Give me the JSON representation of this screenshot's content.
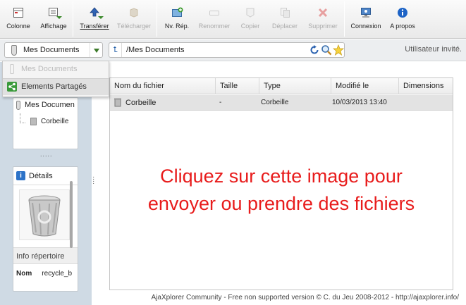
{
  "toolbar": {
    "buttons": [
      {
        "label": "Colonne",
        "icon": "column-view-icon",
        "disabled": false
      },
      {
        "label": "Affichage",
        "icon": "display-mode-icon",
        "disabled": false
      },
      {
        "label": "Transférer",
        "icon": "upload-icon",
        "disabled": false
      },
      {
        "label": "Télécharger",
        "icon": "download-icon",
        "disabled": true
      },
      {
        "label": "Nv. Rép.",
        "icon": "new-folder-icon",
        "disabled": false
      },
      {
        "label": "Renommer",
        "icon": "rename-icon",
        "disabled": true
      },
      {
        "label": "Copier",
        "icon": "copy-icon",
        "disabled": true
      },
      {
        "label": "Déplacer",
        "icon": "move-icon",
        "disabled": true
      },
      {
        "label": "Supprimer",
        "icon": "delete-icon",
        "disabled": true
      },
      {
        "label": "Connexion",
        "icon": "login-icon",
        "disabled": false
      },
      {
        "label": "A propos",
        "icon": "about-icon",
        "disabled": false
      }
    ]
  },
  "pathbar": {
    "repository": "Mes Documents",
    "path": "/Mes Documents",
    "user_status": "Utilisateur invité."
  },
  "repo_dropdown": {
    "items": [
      {
        "label": "Mes Documents",
        "icon": "user-repo-icon"
      },
      {
        "label": "Elements Partagés",
        "icon": "share-icon"
      }
    ]
  },
  "tree": {
    "root": "Mes Documen",
    "child": "Corbeille"
  },
  "details": {
    "title": "Détails",
    "info_section": "Info répertoire",
    "nom_label": "Nom",
    "nom_value": "recycle_b"
  },
  "file_list": {
    "columns": [
      "Nom du fichier",
      "Taille",
      "Type",
      "Modifié le",
      "Dimensions"
    ],
    "rows": [
      {
        "name": "Corbeille",
        "size": "-",
        "type": "Corbeille",
        "modified": "10/03/2013 13:40",
        "dimensions": ""
      }
    ],
    "upload_message_line1": "Cliquez sur cette image pour",
    "upload_message_line2": "envoyer ou prendre des fichiers"
  },
  "footer": "AjaXplorer Community - Free non supported version © C. du Jeu 2008-2012 - http://ajaxplorer.info/",
  "colors": {
    "accent_red": "#e81c1c",
    "toolbar_bg": "#f0f0f0",
    "left_pane_bg": "#cfdae4",
    "selected_row": "#e3e3e3"
  }
}
